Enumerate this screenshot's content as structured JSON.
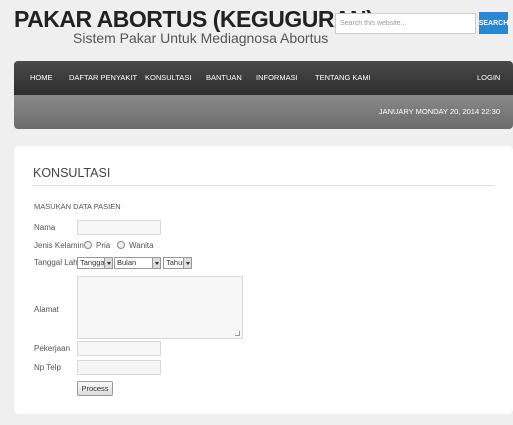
{
  "header": {
    "title": "PAKAR ABORTUS (KEGUGURAN)",
    "subtitle": "Sistem Pakar Untuk Mediagnosa Abortus"
  },
  "search": {
    "placeholder": "Search this website...",
    "button_label": "SEARCH",
    "accent_color": "#2c87d3"
  },
  "nav": {
    "items": [
      {
        "label": "HOME"
      },
      {
        "label": "DAFTAR PENYAKIT"
      },
      {
        "label": "KONSULTASI"
      },
      {
        "label": "BANTUAN"
      },
      {
        "label": "INFORMASI"
      },
      {
        "label": "TENTANG KAMI"
      },
      {
        "label": "LOGIN"
      }
    ]
  },
  "datebar": {
    "text": "JANUARY   MONDAY 20, 2014 22:30"
  },
  "content": {
    "title": "KONSULTASI",
    "section_label": "MASUKAN DATA PASIEN",
    "form": {
      "nama_label": "Nama",
      "jenis_kelamin_label": "Jenis Kelamin",
      "gender_options": [
        "Pria",
        "Wanita"
      ],
      "tanggal_lahir_label": "Tanggal Lahir",
      "tanggal_select": "Tanggal",
      "bulan_select": "Bulan",
      "tahun_select": "Tahun",
      "alamat_label": "Alamat",
      "pekerjaan_label": "Pekerjaan",
      "telp_label": "Np Telp",
      "submit_label": "Process"
    }
  }
}
